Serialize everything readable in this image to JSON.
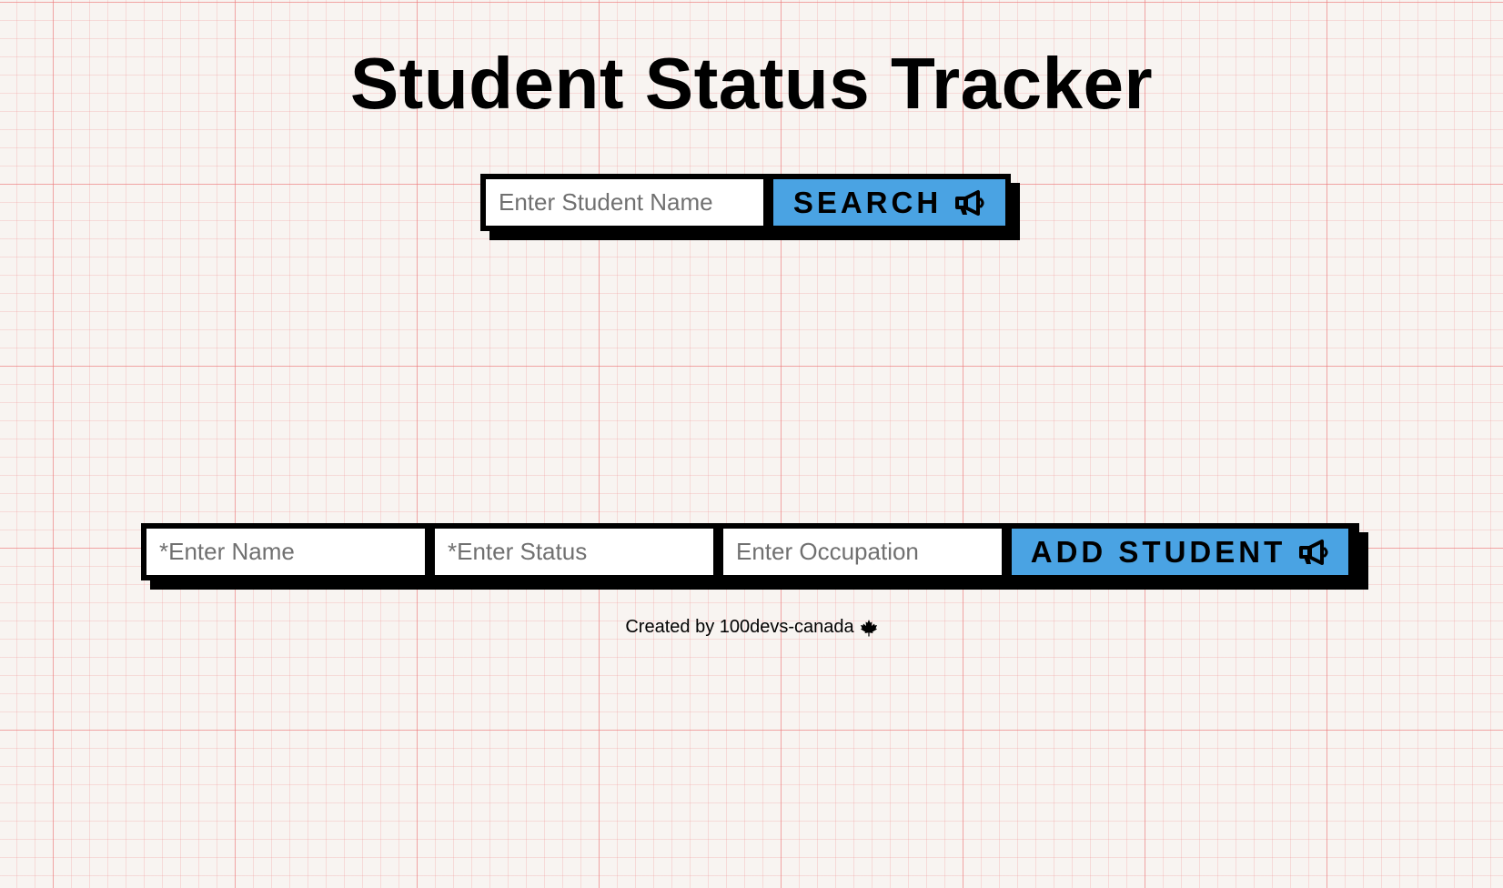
{
  "page": {
    "title": "Student Status Tracker"
  },
  "search": {
    "placeholder": "Enter Student Name",
    "button_label": "SEARCH",
    "button_icon": "megaphone-icon",
    "button_color": "#4aa3e3"
  },
  "add_form": {
    "name_placeholder": "*Enter Name",
    "status_placeholder": "*Enter Status",
    "occupation_placeholder": "Enter Occupation",
    "button_label": "ADD STUDENT",
    "button_icon": "megaphone-icon",
    "button_color": "#4aa3e3"
  },
  "footer": {
    "text": "Created by 100devs-canada",
    "icon": "maple-leaf-icon"
  }
}
